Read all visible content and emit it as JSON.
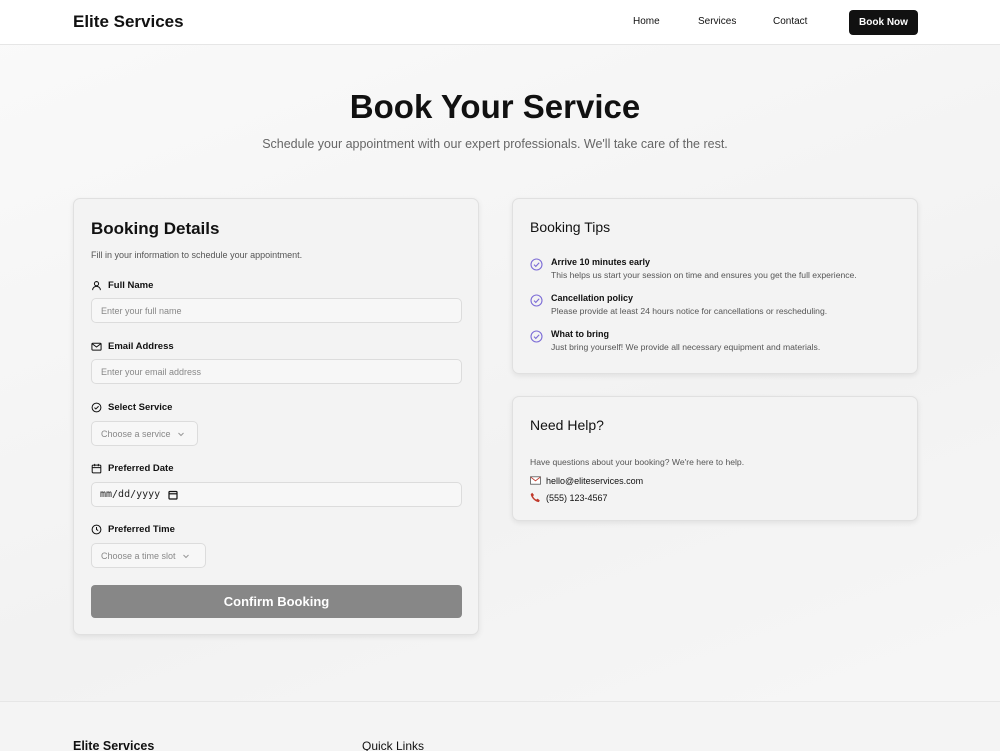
{
  "nav": {
    "brand": "Elite Services",
    "links": [
      "Home",
      "Services",
      "Contact"
    ],
    "cta": "Book Now"
  },
  "hero": {
    "title": "Book Your Service",
    "subtitle": "Schedule your appointment with our expert professionals. We'll take care of the rest."
  },
  "form": {
    "title": "Booking Details",
    "description": "Fill in your information to schedule your appointment.",
    "full_name": {
      "label": "Full Name",
      "placeholder": "Enter your full name"
    },
    "email": {
      "label": "Email Address",
      "placeholder": "Enter your email address"
    },
    "service": {
      "label": "Select Service",
      "value": "Choose a service"
    },
    "date": {
      "label": "Preferred Date",
      "value": "mm/dd/yyyy"
    },
    "time": {
      "label": "Preferred Time",
      "value": "Choose a time slot"
    },
    "submit": "Confirm Booking"
  },
  "tips": {
    "title": "Booking Tips",
    "items": [
      {
        "title": "Arrive 10 minutes early",
        "text": "This helps us start your session on time and ensures you get the full experience."
      },
      {
        "title": "Cancellation policy",
        "text": "Please provide at least 24 hours notice for cancellations or rescheduling."
      },
      {
        "title": "What to bring",
        "text": "Just bring yourself! We provide all necessary equipment and materials."
      }
    ]
  },
  "help": {
    "title": "Need Help?",
    "text": "Have questions about your booking? We're here to help.",
    "email": "hello@eliteservices.com",
    "phone": "(555) 123-4567"
  },
  "footer": {
    "brand": "Elite Services",
    "quick_links": "Quick Links"
  },
  "colors": {
    "accent": "#7c6cd6",
    "button_dark": "#111111",
    "button_disabled": "#878787"
  }
}
